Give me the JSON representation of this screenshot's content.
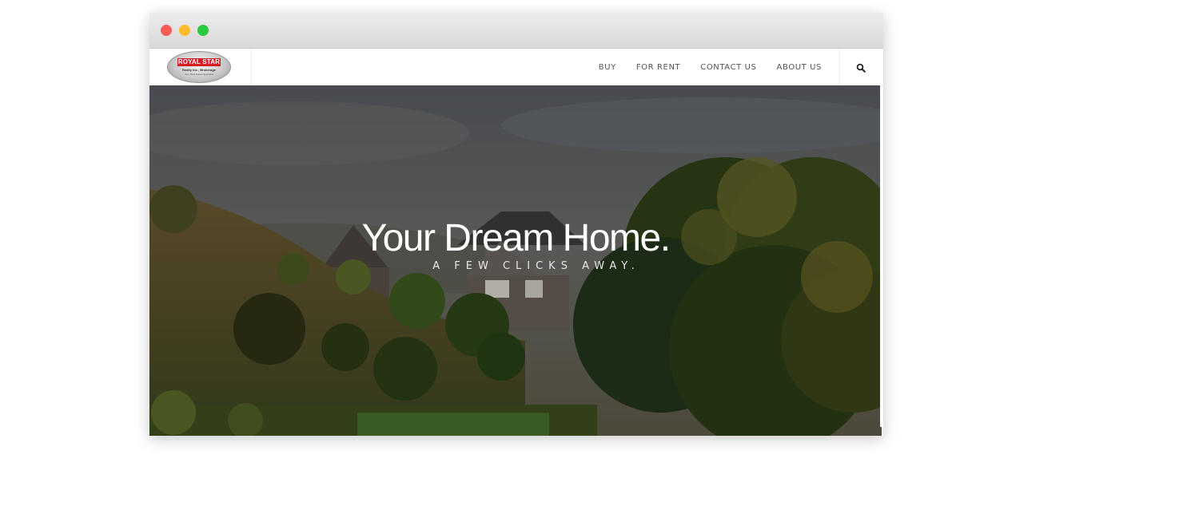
{
  "window": {
    "controls": [
      "close",
      "minimize",
      "maximize"
    ]
  },
  "nav": {
    "logo": {
      "title": "ROYAL STAR",
      "subtitle": "Realty Inc., Brokerage",
      "tagline": "Your Real Estate Specialist"
    },
    "items": [
      {
        "label": "BUY"
      },
      {
        "label": "FOR RENT"
      },
      {
        "label": "CONTACT US"
      },
      {
        "label": "ABOUT US"
      }
    ],
    "search_icon": "search-icon"
  },
  "hero": {
    "title": "Your Dream Home.",
    "subtitle": "A FEW CLICKS AWAY."
  },
  "colors": {
    "close": "#fc5c56",
    "minimize": "#fdbb2e",
    "maximize": "#29c940",
    "logo_red": "#d51f26",
    "nav_text": "#555555"
  }
}
